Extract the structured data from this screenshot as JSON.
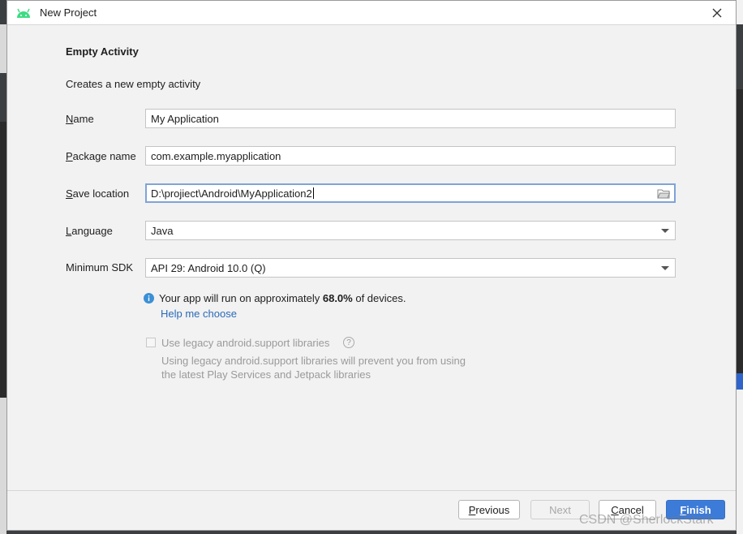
{
  "window": {
    "title": "New Project"
  },
  "page": {
    "heading": "Empty Activity",
    "description": "Creates a new empty activity"
  },
  "form": {
    "name": {
      "label_key": "N",
      "label_rest": "ame",
      "value": "My Application"
    },
    "package": {
      "label_key": "P",
      "label_rest": "ackage name",
      "value": "com.example.myapplication"
    },
    "location": {
      "label_key": "S",
      "label_rest": "ave location",
      "value": "D:\\projiect\\Android\\MyApplication2"
    },
    "language": {
      "label_key": "L",
      "label_rest": "anguage",
      "value": "Java"
    },
    "min_sdk": {
      "label": "Minimum SDK",
      "value": "API 29: Android 10.0 (Q)"
    }
  },
  "info": {
    "text_before": "Your app will run on approximately ",
    "percent": "68.0%",
    "text_after": " of devices.",
    "help_link": "Help me choose"
  },
  "legacy": {
    "label": "Use legacy android.support libraries",
    "desc_line1": "Using legacy android.support libraries will prevent you from using",
    "desc_line2": "the latest Play Services and Jetpack libraries",
    "help_glyph": "?"
  },
  "buttons": {
    "previous_key": "P",
    "previous_rest": "revious",
    "next": "Next",
    "cancel_key": "C",
    "cancel_rest": "ancel",
    "finish_key": "F",
    "finish_rest": "inish"
  },
  "watermark": "CSDN @SherlockStark",
  "colors": {
    "accent": "#3d7bd8",
    "link": "#2a6ab8",
    "android_green": "#3ddc84",
    "info_blue": "#3b8fd6"
  }
}
